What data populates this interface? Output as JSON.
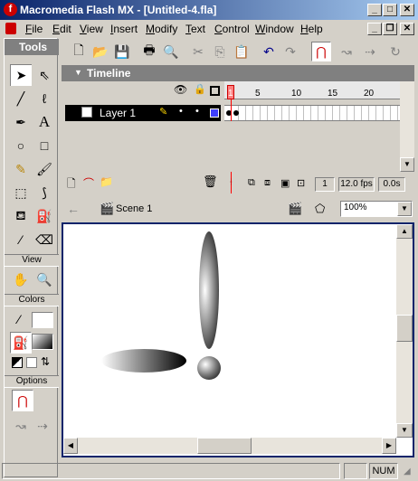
{
  "window": {
    "title": "Macromedia Flash MX - [Untitled-4.fla]"
  },
  "menu": [
    {
      "pre": "",
      "u": "F",
      "post": "ile"
    },
    {
      "pre": "",
      "u": "E",
      "post": "dit"
    },
    {
      "pre": "",
      "u": "V",
      "post": "iew"
    },
    {
      "pre": "",
      "u": "I",
      "post": "nsert"
    },
    {
      "pre": "",
      "u": "M",
      "post": "odify"
    },
    {
      "pre": "",
      "u": "T",
      "post": "ext"
    },
    {
      "pre": "",
      "u": "C",
      "post": "ontrol"
    },
    {
      "pre": "",
      "u": "W",
      "post": "indow"
    },
    {
      "pre": "",
      "u": "H",
      "post": "elp"
    }
  ],
  "tools": {
    "title": "Tools",
    "view_label": "View",
    "colors_label": "Colors",
    "options_label": "Options"
  },
  "timeline": {
    "title": "Timeline",
    "layer_name": "Layer 1",
    "frame_numbers": [
      "1",
      "5",
      "10",
      "15",
      "20"
    ],
    "current_frame": "1",
    "fps": "12.0 fps",
    "elapsed": "0.0s"
  },
  "scene": {
    "name": "Scene 1",
    "zoom": "100%"
  },
  "status": {
    "num": "NUM"
  },
  "colors": {
    "title_start": "#0a246a",
    "title_end": "#a6caf0",
    "selection": "#0a246a",
    "playhead": "#ff0000"
  }
}
